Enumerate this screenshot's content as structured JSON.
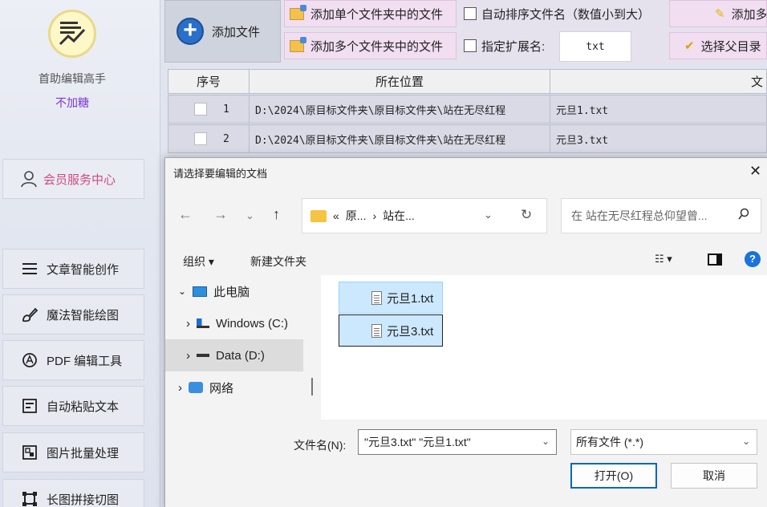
{
  "sidebar": {
    "app_name": "首助编辑高手",
    "app_sub": "不加糖",
    "member_center": "会员服务中心",
    "items": [
      {
        "label": "文章智能创作",
        "icon": "list-icon"
      },
      {
        "label": "魔法智能绘图",
        "icon": "brush-icon"
      },
      {
        "label": "PDF 编辑工具",
        "icon": "pdf-icon"
      },
      {
        "label": "自动粘贴文本",
        "icon": "paste-icon"
      },
      {
        "label": "图片批量处理",
        "icon": "image-icon"
      },
      {
        "label": "长图拼接切图",
        "icon": "crop-icon"
      }
    ]
  },
  "toolbar": {
    "add_file": "添加文件",
    "add_single_folder": "添加单个文件夹中的文件",
    "add_multi_folder": "添加多个文件夹中的文件",
    "auto_sort": "自动排序文件名（数值小到大）",
    "ext_label": "指定扩展名:",
    "ext_value": "txt",
    "add_more": "添加多",
    "select_parent": "选择父目录"
  },
  "table": {
    "headers": [
      "序号",
      "所在位置",
      "文"
    ],
    "rows": [
      {
        "index": "1",
        "path": "D:\\2024\\原目标文件夹\\原目标文件夹\\站在无尽红程",
        "name": "元旦1.txt"
      },
      {
        "index": "2",
        "path": "D:\\2024\\原目标文件夹\\原目标文件夹\\站在无尽红程",
        "name": "元旦3.txt"
      }
    ]
  },
  "dialog": {
    "title": "请选择要编辑的文档",
    "address": {
      "prefix": "«",
      "crumb1": "原...",
      "sep": "›",
      "crumb2": "站在..."
    },
    "search_placeholder": "在 站在无尽红程总仰望曾...",
    "organize": "组织 ▾",
    "new_folder": "新建文件夹",
    "tree": [
      {
        "label": "此电脑",
        "chevron": "⌄"
      },
      {
        "label": "Windows (C:)",
        "chevron": "›"
      },
      {
        "label": "Data (D:)",
        "chevron": "›"
      },
      {
        "label": "网络",
        "chevron": "›"
      }
    ],
    "files": [
      "元旦1.txt",
      "元旦3.txt"
    ],
    "filename_label": "文件名(N):",
    "filename_value": "\"元旦3.txt\" \"元旦1.txt\"",
    "filetype": "所有文件 (*.*)",
    "open": "打开(O)",
    "cancel": "取消"
  }
}
